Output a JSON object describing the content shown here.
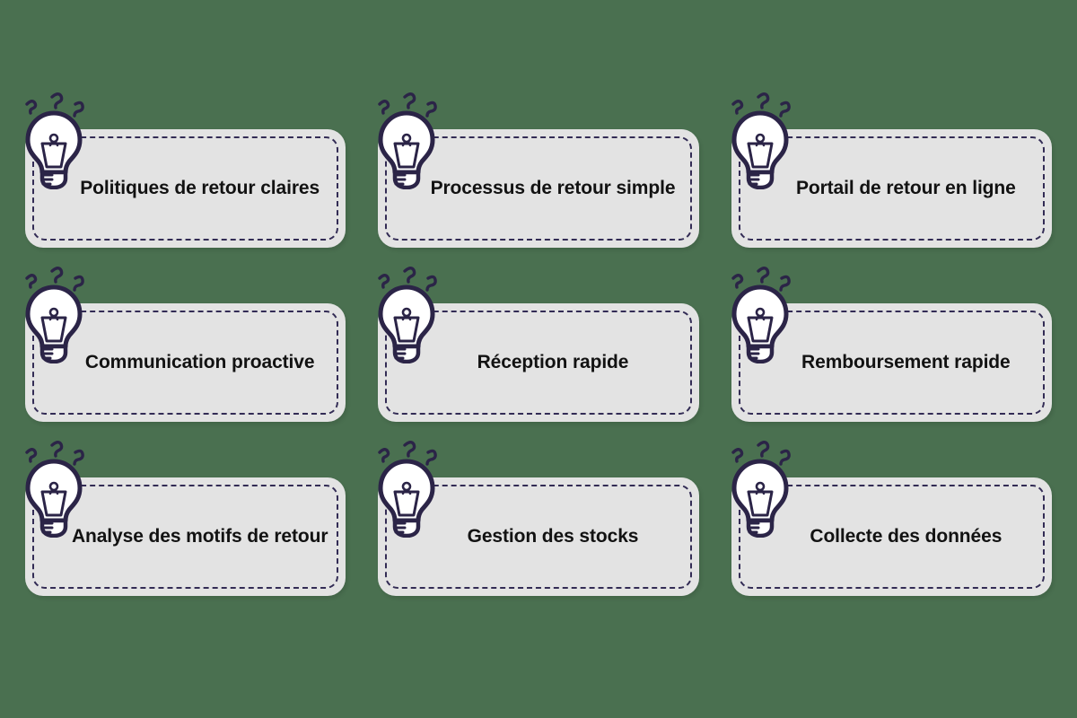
{
  "page": {
    "background_color": "#4a7050",
    "card_fill_color": "#e3e3e3",
    "card_border_color": "#332c55",
    "icon_stroke_color": "#2b2447",
    "icon_fill_color": "#ffffff",
    "text_color": "#121212",
    "layout": {
      "columns": 3,
      "rows": 3
    }
  },
  "icon": {
    "name": "lightbulb-idea-icon",
    "sparks": 3
  },
  "cards": [
    {
      "id": "politiques-de-retour-claires",
      "label": "Politiques de retour claires",
      "icon": "lightbulb-idea-icon"
    },
    {
      "id": "processus-de-retour-simple",
      "label": "Processus de retour simple",
      "icon": "lightbulb-idea-icon"
    },
    {
      "id": "portail-de-retour-en-ligne",
      "label": "Portail de retour en ligne",
      "icon": "lightbulb-idea-icon"
    },
    {
      "id": "communication-proactive",
      "label": "Communication proactive",
      "icon": "lightbulb-idea-icon"
    },
    {
      "id": "reception-rapide",
      "label": "Réception rapide",
      "icon": "lightbulb-idea-icon"
    },
    {
      "id": "remboursement-rapide",
      "label": "Remboursement rapide",
      "icon": "lightbulb-idea-icon"
    },
    {
      "id": "analyse-des-motifs-de-retour",
      "label": "Analyse des motifs de retour",
      "icon": "lightbulb-idea-icon"
    },
    {
      "id": "gestion-des-stocks",
      "label": "Gestion des stocks",
      "icon": "lightbulb-idea-icon"
    },
    {
      "id": "collecte-des-donnees",
      "label": "Collecte des données",
      "icon": "lightbulb-idea-icon"
    }
  ]
}
